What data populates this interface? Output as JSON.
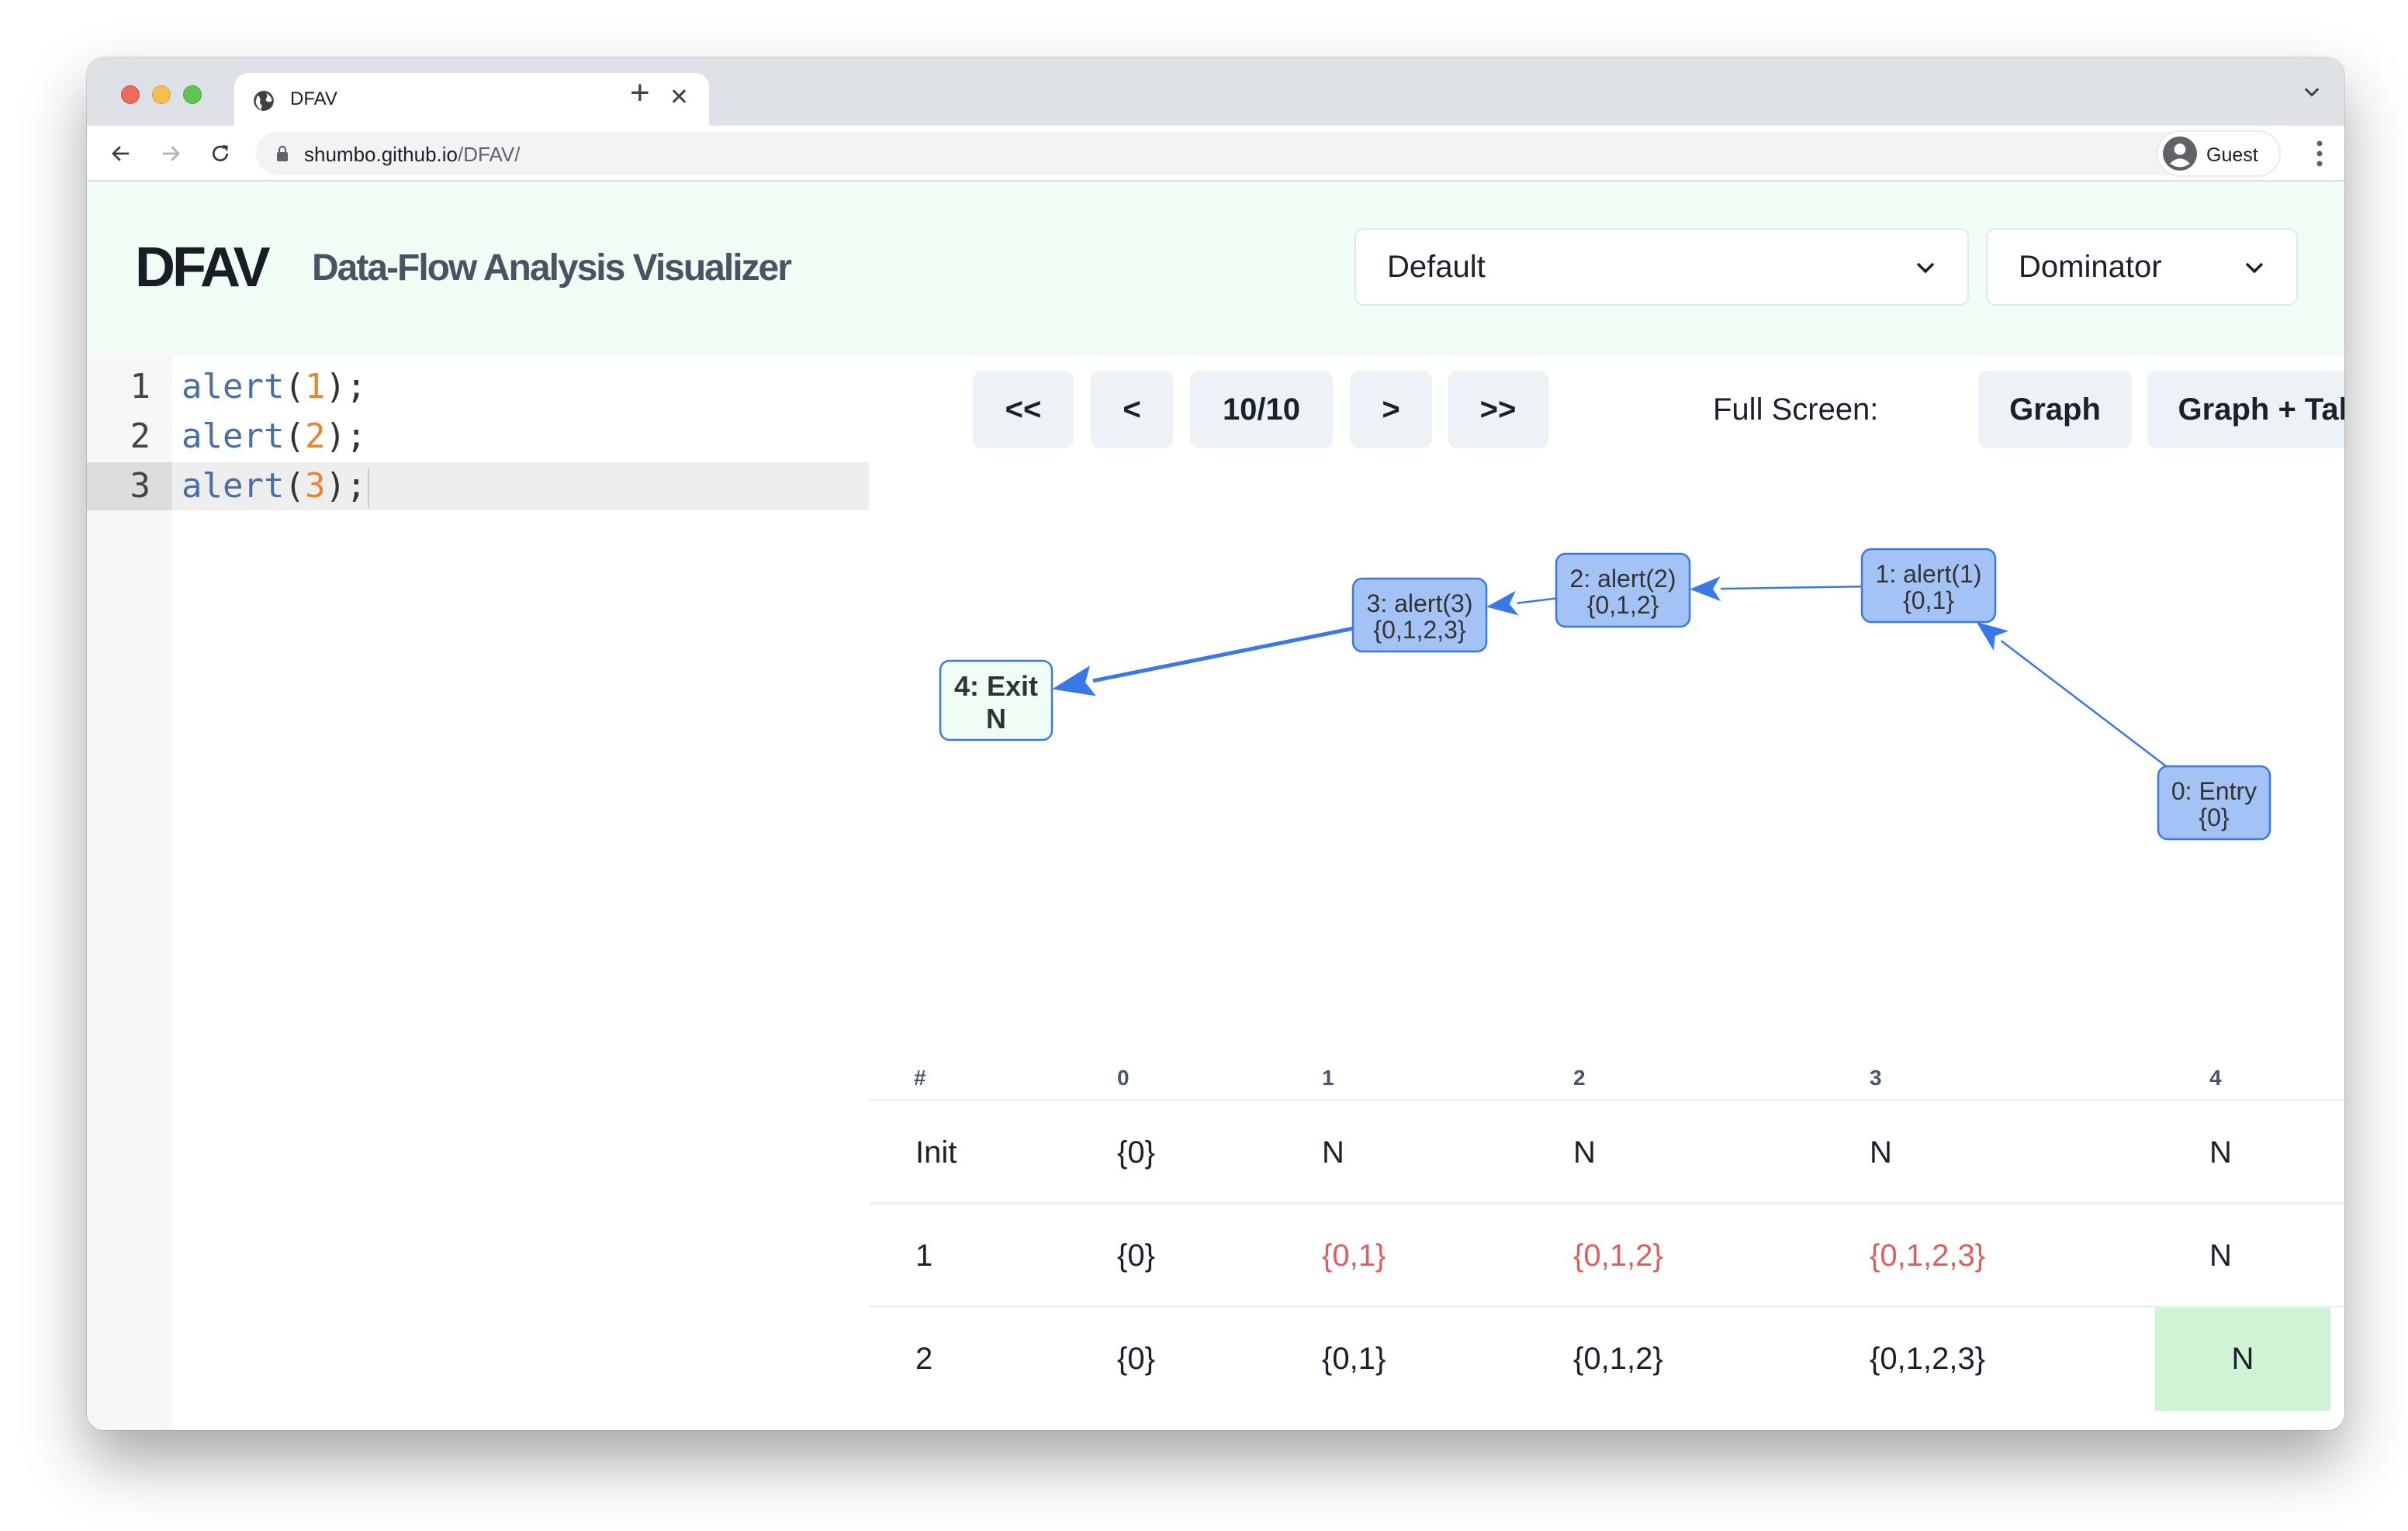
{
  "browser": {
    "tab_title": "DFAV",
    "url_host": "shumbo.github.io",
    "url_path": "/DFAV/",
    "profile_label": "Guest"
  },
  "header": {
    "logo": "DFAV",
    "subtitle": "Data-Flow Analysis Visualizer",
    "example_select": {
      "value": "Default"
    },
    "analysis_select": {
      "value": "Dominator"
    }
  },
  "editor": {
    "active_line": 3,
    "lines": [
      {
        "number": "1",
        "fn": "alert",
        "open": "(",
        "arg": "1",
        "close": ");"
      },
      {
        "number": "2",
        "fn": "alert",
        "open": "(",
        "arg": "2",
        "close": ");"
      },
      {
        "number": "3",
        "fn": "alert",
        "open": "(",
        "arg": "3",
        "close": ");"
      }
    ]
  },
  "controls": {
    "first_label": "<<",
    "prev_label": "<",
    "step_label": "10/10",
    "next_label": ">",
    "last_label": ">>",
    "fullscreen_label": "Full Screen:",
    "graph_label": "Graph",
    "graph_table_label": "Graph + Table"
  },
  "graph": {
    "colors": {
      "node_fill": "#a3c2f5",
      "node_stroke": "#3b78e7",
      "exit_fill": "#f0fdf4",
      "edge": "#3b78e7",
      "text": "#333333"
    },
    "nodes": [
      {
        "id": "0",
        "label": "0: Entry",
        "value": "{0}",
        "kind": "normal"
      },
      {
        "id": "1",
        "label": "1: alert(1)",
        "value": "{0,1}",
        "kind": "normal"
      },
      {
        "id": "2",
        "label": "2: alert(2)",
        "value": "{0,1,2}",
        "kind": "normal"
      },
      {
        "id": "3",
        "label": "3: alert(3)",
        "value": "{0,1,2,3}",
        "kind": "normal"
      },
      {
        "id": "4",
        "label": "4: Exit",
        "value": "N",
        "kind": "current"
      }
    ],
    "edges": [
      {
        "from": "0",
        "to": "1",
        "emphasis": false
      },
      {
        "from": "1",
        "to": "2",
        "emphasis": false
      },
      {
        "from": "2",
        "to": "3",
        "emphasis": false
      },
      {
        "from": "3",
        "to": "4",
        "emphasis": true
      }
    ]
  },
  "table": {
    "headers": [
      "#",
      "0",
      "1",
      "2",
      "3",
      "4"
    ],
    "rows": [
      {
        "cells": [
          "Init",
          "{0}",
          "N",
          "N",
          "N",
          "N"
        ],
        "changed": [],
        "highlight": []
      },
      {
        "cells": [
          "1",
          "{0}",
          "{0,1}",
          "{0,1,2}",
          "{0,1,2,3}",
          "N"
        ],
        "changed": [
          2,
          3,
          4
        ],
        "highlight": []
      },
      {
        "cells": [
          "2",
          "{0}",
          "{0,1}",
          "{0,1,2}",
          "{0,1,2,3}",
          "N"
        ],
        "changed": [],
        "highlight": [
          5
        ]
      }
    ],
    "colors": {
      "changed": "#e05d5d",
      "highlight": "#cff4d5"
    }
  }
}
